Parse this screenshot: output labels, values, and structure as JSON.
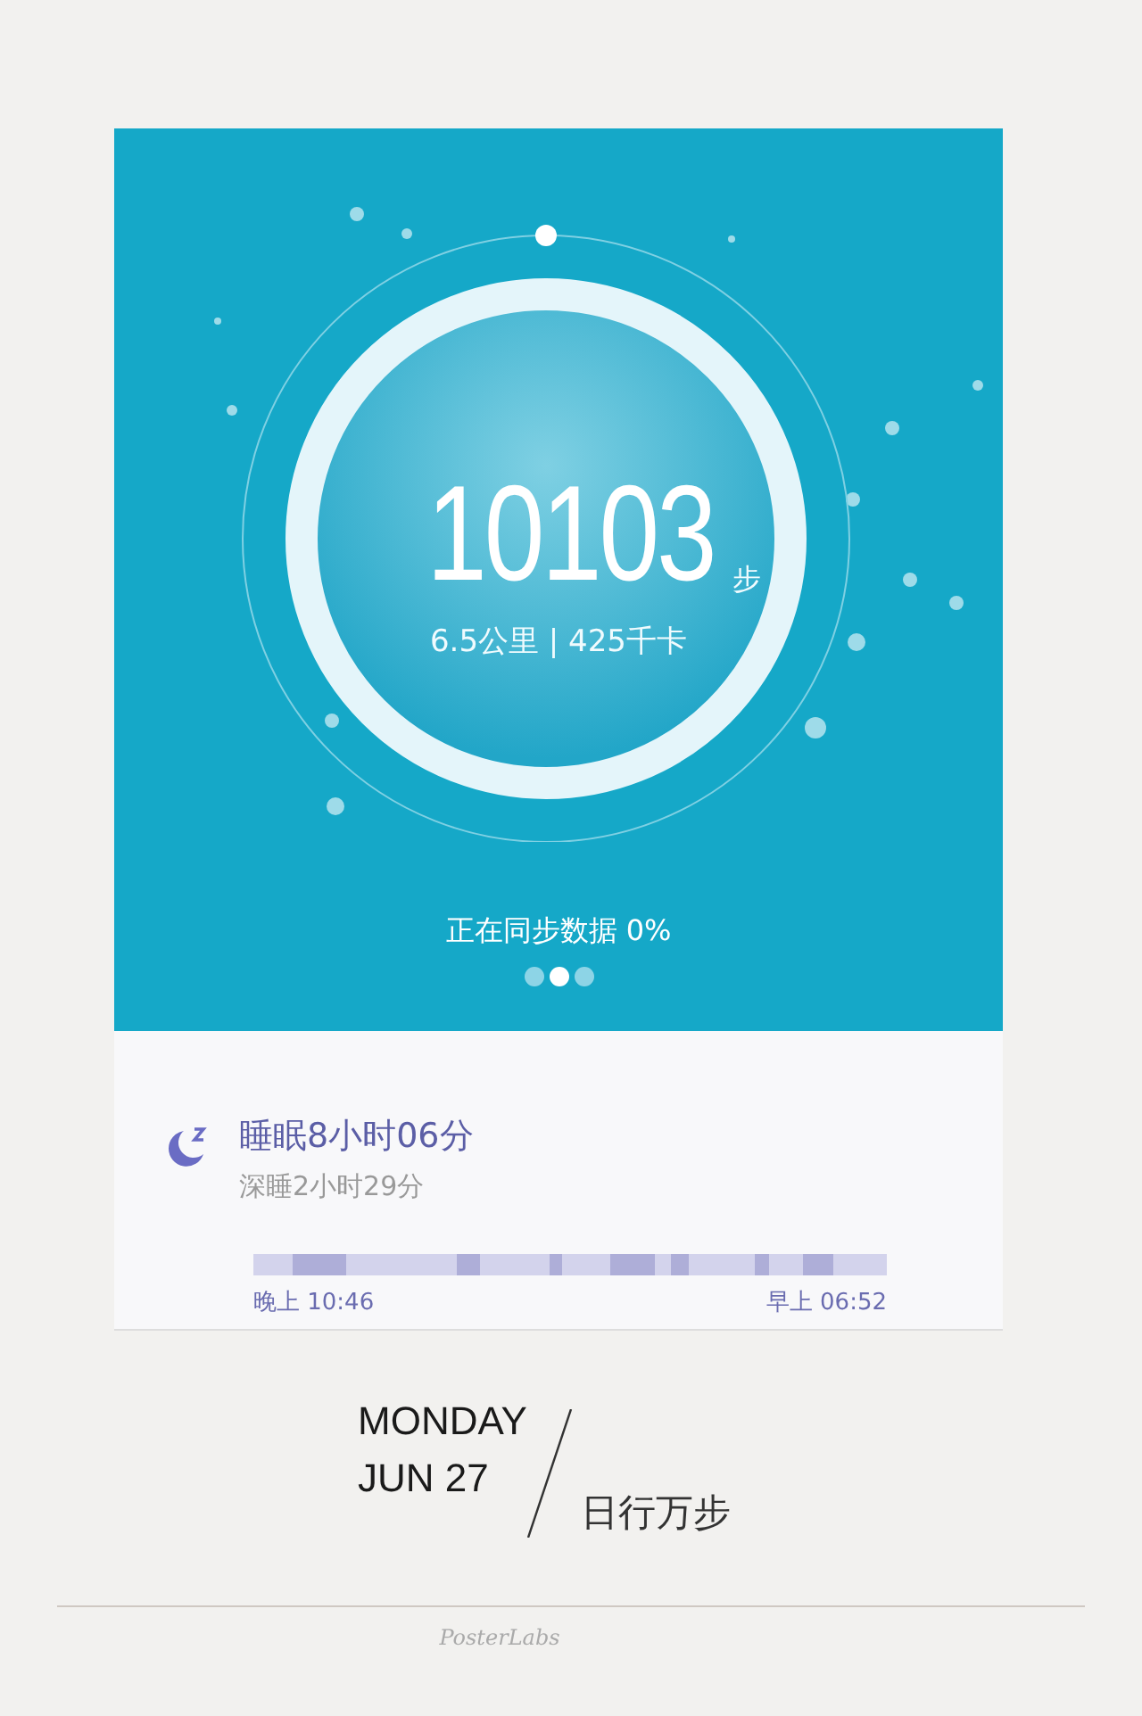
{
  "steps": {
    "count": "10103",
    "unit": "步",
    "summary": "6.5公里 | 425千卡"
  },
  "sync": {
    "text": "正在同步数据 0%"
  },
  "pager": [
    {
      "selected": false
    },
    {
      "selected": true
    },
    {
      "selected": false
    }
  ],
  "sleep": {
    "title": "睡眠8小时06分",
    "deep": "深睡2小时29分",
    "start": "晚上 10:46",
    "end": "早上 06:52"
  },
  "date": {
    "weekday": "MONDAY",
    "day": "JUN 27",
    "motto": "日行万步"
  },
  "footer": {
    "brand": "PosterLabs"
  }
}
